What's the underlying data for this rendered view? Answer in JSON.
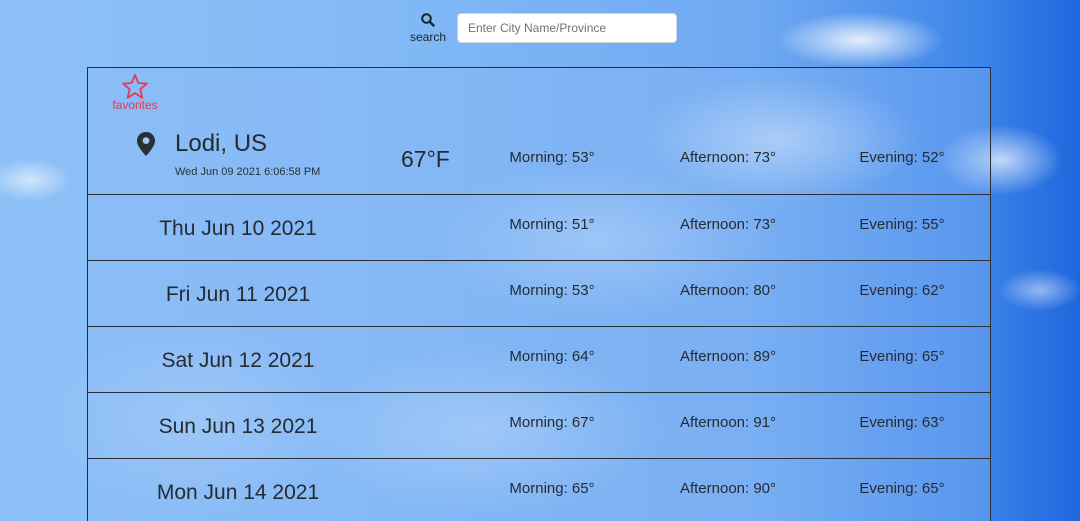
{
  "search": {
    "label": "search",
    "placeholder": "Enter City Name/Province",
    "value": ""
  },
  "favorites": {
    "label": "favorites",
    "icon": "star-outline-icon",
    "color": "#e03c52"
  },
  "current": {
    "location_icon": "map-pin-icon",
    "city": "Lodi, US",
    "datetime": "Wed Jun 09 2021 6:06:58 PM",
    "temperature": "67°F",
    "morning": "Morning: 53°",
    "afternoon": "Afternoon: 73°",
    "evening": "Evening: 52°"
  },
  "forecast": [
    {
      "date": "Thu Jun 10 2021",
      "morning": "Morning: 51°",
      "afternoon": "Afternoon: 73°",
      "evening": "Evening: 55°"
    },
    {
      "date": "Fri Jun 11 2021",
      "morning": "Morning: 53°",
      "afternoon": "Afternoon: 80°",
      "evening": "Evening: 62°"
    },
    {
      "date": "Sat Jun 12 2021",
      "morning": "Morning: 64°",
      "afternoon": "Afternoon: 89°",
      "evening": "Evening: 65°"
    },
    {
      "date": "Sun Jun 13 2021",
      "morning": "Morning: 67°",
      "afternoon": "Afternoon: 91°",
      "evening": "Evening: 63°"
    },
    {
      "date": "Mon Jun 14 2021",
      "morning": "Morning: 65°",
      "afternoon": "Afternoon: 90°",
      "evening": "Evening: 65°"
    }
  ]
}
